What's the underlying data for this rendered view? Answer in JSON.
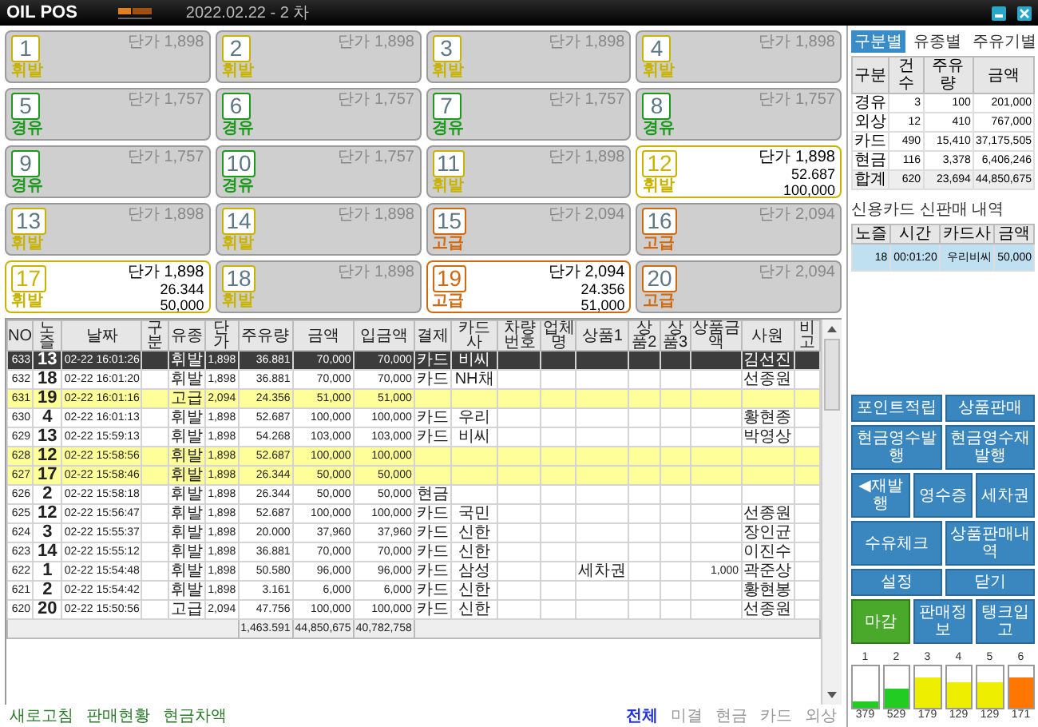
{
  "header": {
    "title": "OIL POS",
    "date": "2022.02.22 - 2 차"
  },
  "pumps": [
    {
      "number": "1",
      "price": "단가 1,898",
      "fuel_label": "휘발",
      "color": "#c8b400",
      "active": false
    },
    {
      "number": "2",
      "price": "단가 1,898",
      "fuel_label": "휘발",
      "color": "#c8b400",
      "active": false
    },
    {
      "number": "3",
      "price": "단가 1,898",
      "fuel_label": "휘발",
      "color": "#c8b400",
      "active": false
    },
    {
      "number": "4",
      "price": "단가 1,898",
      "fuel_label": "휘발",
      "color": "#c8b400",
      "active": false
    },
    {
      "number": "5",
      "price": "단가 1,757",
      "fuel_label": "경유",
      "color": "#1a9a1a",
      "active": false
    },
    {
      "number": "6",
      "price": "단가 1,757",
      "fuel_label": "경유",
      "color": "#1a9a1a",
      "active": false
    },
    {
      "number": "7",
      "price": "단가 1,757",
      "fuel_label": "경유",
      "color": "#1a9a1a",
      "active": false
    },
    {
      "number": "8",
      "price": "단가 1,757",
      "fuel_label": "경유",
      "color": "#1a9a1a",
      "active": false
    },
    {
      "number": "9",
      "price": "단가 1,757",
      "fuel_label": "경유",
      "color": "#1a9a1a",
      "active": false
    },
    {
      "number": "10",
      "price": "단가 1,757",
      "fuel_label": "경유",
      "color": "#1a9a1a",
      "active": false
    },
    {
      "number": "11",
      "price": "단가 1,898",
      "fuel_label": "휘발",
      "color": "#c8b400",
      "active": false
    },
    {
      "number": "12",
      "price": "단가 1,898",
      "fuel_label": "휘발",
      "color": "#c8b400",
      "active": true,
      "volume": "52.687",
      "amount": "100,000"
    },
    {
      "number": "13",
      "price": "단가 1,898",
      "fuel_label": "휘발",
      "color": "#c8b400",
      "active": false
    },
    {
      "number": "14",
      "price": "단가 1,898",
      "fuel_label": "휘발",
      "color": "#c8b400",
      "active": false
    },
    {
      "number": "15",
      "price": "단가 2,094",
      "fuel_label": "고급",
      "color": "#d06a10",
      "active": false
    },
    {
      "number": "16",
      "price": "단가 2,094",
      "fuel_label": "고급",
      "color": "#d06a10",
      "active": false
    },
    {
      "number": "17",
      "price": "단가 1,898",
      "fuel_label": "휘발",
      "color": "#c8b400",
      "active": true,
      "volume": "26.344",
      "amount": "50,000"
    },
    {
      "number": "18",
      "price": "단가 1,898",
      "fuel_label": "휘발",
      "color": "#c8b400",
      "active": false
    },
    {
      "number": "19",
      "price": "단가 2,094",
      "fuel_label": "고급",
      "color": "#d06a10",
      "active": true,
      "volume": "24.356",
      "amount": "51,000"
    },
    {
      "number": "20",
      "price": "단가 2,094",
      "fuel_label": "고급",
      "color": "#d06a10",
      "active": false
    }
  ],
  "sales_table": {
    "columns": [
      "NO",
      "노즐",
      "날짜",
      "구분",
      "유종",
      "단가",
      "주유량",
      "금액",
      "입금액",
      "결제",
      "카드사",
      "차량번호",
      "업체명",
      "상품1",
      "상품2",
      "상품3",
      "상품금액",
      "사원",
      "비고"
    ],
    "rows": [
      {
        "selected": true,
        "unpaid": false,
        "cells": [
          "633",
          "13",
          "02-22 16:01:26",
          null,
          "휘발",
          "1,898",
          "36.881",
          "70,000",
          "70,000",
          "카드",
          "비씨",
          null,
          null,
          null,
          null,
          null,
          null,
          "김선진",
          null
        ]
      },
      {
        "selected": false,
        "unpaid": false,
        "cells": [
          "632",
          "18",
          "02-22 16:01:20",
          null,
          "휘발",
          "1,898",
          "36.881",
          "70,000",
          "70,000",
          "카드",
          "NH채",
          null,
          null,
          null,
          null,
          null,
          null,
          "선종원",
          null
        ]
      },
      {
        "selected": false,
        "unpaid": true,
        "cells": [
          "631",
          "19",
          "02-22 16:01:16",
          null,
          "고급",
          "2,094",
          "24.356",
          "51,000",
          "51,000",
          null,
          null,
          null,
          null,
          null,
          null,
          null,
          null,
          null,
          null
        ]
      },
      {
        "selected": false,
        "unpaid": false,
        "cells": [
          "630",
          "4",
          "02-22 16:01:13",
          null,
          "휘발",
          "1,898",
          "52.687",
          "100,000",
          "100,000",
          "카드",
          "우리",
          null,
          null,
          null,
          null,
          null,
          null,
          "황현종",
          null
        ]
      },
      {
        "selected": false,
        "unpaid": false,
        "cells": [
          "629",
          "13",
          "02-22 15:59:13",
          null,
          "휘발",
          "1,898",
          "54.268",
          "103,000",
          "103,000",
          "카드",
          "비씨",
          null,
          null,
          null,
          null,
          null,
          null,
          "박영상",
          null
        ]
      },
      {
        "selected": false,
        "unpaid": true,
        "cells": [
          "628",
          "12",
          "02-22 15:58:56",
          null,
          "휘발",
          "1,898",
          "52.687",
          "100,000",
          "100,000",
          null,
          null,
          null,
          null,
          null,
          null,
          null,
          null,
          null,
          null
        ]
      },
      {
        "selected": false,
        "unpaid": true,
        "cells": [
          "627",
          "17",
          "02-22 15:58:46",
          null,
          "휘발",
          "1,898",
          "26.344",
          "50,000",
          "50,000",
          null,
          null,
          null,
          null,
          null,
          null,
          null,
          null,
          null,
          null
        ]
      },
      {
        "selected": false,
        "unpaid": false,
        "cells": [
          "626",
          "2",
          "02-22 15:58:18",
          null,
          "휘발",
          "1,898",
          "26.344",
          "50,000",
          "50,000",
          "현금",
          null,
          null,
          null,
          null,
          null,
          null,
          null,
          null,
          null
        ]
      },
      {
        "selected": false,
        "unpaid": false,
        "cells": [
          "625",
          "12",
          "02-22 15:56:47",
          null,
          "휘발",
          "1,898",
          "52.687",
          "100,000",
          "100,000",
          "카드",
          "국민",
          null,
          null,
          null,
          null,
          null,
          null,
          "선종원",
          null
        ]
      },
      {
        "selected": false,
        "unpaid": false,
        "cells": [
          "624",
          "3",
          "02-22 15:55:37",
          null,
          "휘발",
          "1,898",
          "20.000",
          "37,960",
          "37,960",
          "카드",
          "신한",
          null,
          null,
          null,
          null,
          null,
          null,
          "장인균",
          null
        ]
      },
      {
        "selected": false,
        "unpaid": false,
        "cells": [
          "623",
          "14",
          "02-22 15:55:12",
          null,
          "휘발",
          "1,898",
          "36.881",
          "70,000",
          "70,000",
          "카드",
          "신한",
          null,
          null,
          null,
          null,
          null,
          null,
          "이진수",
          null
        ]
      },
      {
        "selected": false,
        "unpaid": false,
        "cells": [
          "622",
          "1",
          "02-22 15:54:48",
          null,
          "휘발",
          "1,898",
          "50.580",
          "96,000",
          "96,000",
          "카드",
          "삼성",
          null,
          null,
          "세차권",
          null,
          null,
          "1,000",
          "곽준상",
          null
        ]
      },
      {
        "selected": false,
        "unpaid": false,
        "cells": [
          "621",
          "2",
          "02-22 15:54:42",
          null,
          "휘발",
          "1,898",
          "3.161",
          "6,000",
          "6,000",
          "카드",
          "신한",
          null,
          null,
          null,
          null,
          null,
          null,
          "황현봉",
          null
        ]
      },
      {
        "selected": false,
        "unpaid": false,
        "cells": [
          "620",
          "20",
          "02-22 15:50:56",
          null,
          "고급",
          "2,094",
          "47.756",
          "100,000",
          "100,000",
          "카드",
          "신한",
          null,
          null,
          null,
          null,
          null,
          null,
          "선종원",
          null
        ]
      }
    ],
    "totals": {
      "volume": "1,463.591",
      "amount": "44,850,675",
      "received": "40,782,758"
    }
  },
  "bottom_links": [
    "새로고침",
    "판매현황",
    "현금차액"
  ],
  "filters": [
    {
      "label": "전체",
      "selected": true
    },
    {
      "label": "미결",
      "selected": false
    },
    {
      "label": "현금",
      "selected": false
    },
    {
      "label": "카드",
      "selected": false
    },
    {
      "label": "외상",
      "selected": false
    }
  ],
  "summary": {
    "tabs": [
      {
        "label": "구분별",
        "selected": true
      },
      {
        "label": "유종별",
        "selected": false
      },
      {
        "label": "주유기별",
        "selected": false
      }
    ],
    "columns": [
      "구분",
      "건수",
      "주유량",
      "금액"
    ],
    "rows": [
      [
        "경유",
        "3",
        "100",
        "201,000"
      ],
      [
        "외상",
        "12",
        "410",
        "767,000"
      ],
      [
        "카드",
        "490",
        "15,410",
        "37,175,505"
      ],
      [
        "현금",
        "116",
        "3,378",
        "6,406,246"
      ]
    ],
    "total": [
      "합계",
      "620",
      "23,694",
      "44,850,675"
    ]
  },
  "card_history": {
    "title": "신용카드 신판매 내역",
    "columns": [
      "노즐",
      "시간",
      "카드사",
      "금액"
    ],
    "rows": [
      {
        "selected": true,
        "cells": [
          "18",
          "00:01:20",
          "우리비씨",
          "50,000"
        ]
      }
    ]
  },
  "buttons": [
    [
      {
        "label": "포인트적립",
        "kind": "action"
      },
      {
        "label": "상품판매",
        "kind": "action"
      }
    ],
    [
      {
        "label": "현금영수발행",
        "kind": "action"
      },
      {
        "label": "현금영수재발행",
        "kind": "action"
      }
    ],
    [
      {
        "label": "◀재발행",
        "kind": "action"
      },
      {
        "label": "영수증",
        "kind": "action"
      },
      {
        "label": "세차권",
        "kind": "action"
      }
    ],
    [
      {
        "label": "수유체크",
        "kind": "action"
      },
      {
        "label": "상품판매내역",
        "kind": "action"
      }
    ],
    [
      {
        "label": "설정",
        "kind": "action"
      },
      {
        "label": "닫기",
        "kind": "action"
      }
    ],
    [
      {
        "label": "마감",
        "kind": "close"
      },
      {
        "label": "판매정보",
        "kind": "action"
      },
      {
        "label": "탱크입고",
        "kind": "action"
      }
    ]
  ],
  "tanks": [
    {
      "label": "1",
      "level": 0.15,
      "color": "#22cc22",
      "reading": "379"
    },
    {
      "label": "2",
      "level": 0.45,
      "color": "#22cc22",
      "reading": "529"
    },
    {
      "label": "3",
      "level": 0.75,
      "color": "#eeee00",
      "reading": "179"
    },
    {
      "label": "4",
      "level": 0.6,
      "color": "#eeee00",
      "reading": "129"
    },
    {
      "label": "5",
      "level": 0.6,
      "color": "#eeee00",
      "reading": "129"
    },
    {
      "label": "6",
      "level": 0.75,
      "color": "#ff7700",
      "reading": "171"
    }
  ]
}
